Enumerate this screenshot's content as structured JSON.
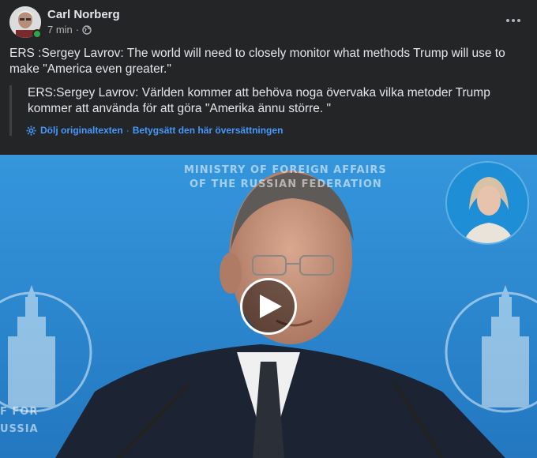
{
  "post": {
    "author": "Carl Norberg",
    "time": "7 min",
    "separator": "·",
    "audience_icon": "globe-icon",
    "more_icon": "more-options-icon",
    "text": "ERS :Sergey Lavrov: The world will need to closely monitor what methods Trump will use to make \"America even greater.\"",
    "translation": {
      "text": "ERS:Sergey Lavrov: Världen kommer att behöva noga övervaka vilka metoder Trump kommer att använda för att göra \"Amerika ännu större. \"",
      "hide_label": "Dölj originaltexten",
      "dot": "·",
      "rate_label": "Betygsätt den här översättningen"
    }
  },
  "video": {
    "backdrop_line1": "MINISTRY OF FOREIGN AFFAIRS",
    "backdrop_line2": "OF THE RUSSIAN FEDERATION",
    "backdrop_left": "F FOR",
    "backdrop_left2": "USSIA",
    "play_icon": "play-icon",
    "colors": {
      "backdrop": "#2b86cf",
      "suit": "#1c2433"
    }
  }
}
